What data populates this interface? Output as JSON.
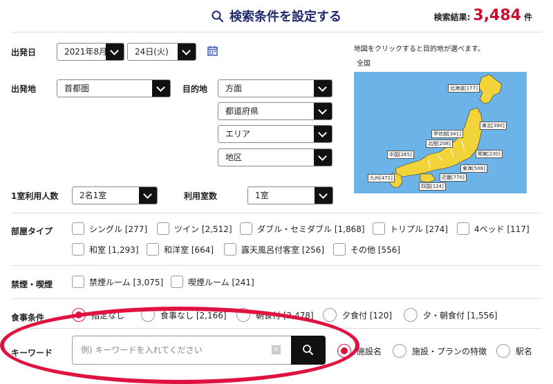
{
  "header": {
    "title": "検索条件を設定する",
    "results_label": "検索結果:",
    "results_count": "3,484",
    "results_unit": "件"
  },
  "departure_date": {
    "label": "出発日",
    "month": "2021年8月",
    "day": "24日(火)"
  },
  "departure_place": {
    "label": "出発地",
    "value": "首都圏"
  },
  "destination": {
    "label": "目的地",
    "selects": [
      "方面",
      "都道府県",
      "エリア",
      "地区"
    ]
  },
  "map": {
    "hint": "地図をクリックすると目的地が選べます。",
    "scope": "全国",
    "regions": [
      "北海道[177]",
      "東北[390]",
      "甲信越[341]",
      "北陸[208]",
      "関東[230]",
      "中国[265]",
      "東海[508]",
      "九州[471]",
      "近畿[770]",
      "四国[124]"
    ]
  },
  "persons": {
    "label": "1室利用人数",
    "value": "2名1室"
  },
  "rooms": {
    "label": "利用室数",
    "value": "1室"
  },
  "room_type": {
    "label": "部屋タイプ",
    "options": [
      "シングル [277]",
      "ツイン [2,512]",
      "ダブル・セミダブル [1,868]",
      "トリプル [274]",
      "4ベッド [117]",
      "和室 [1,293]",
      "和洋室 [664]",
      "露天風呂付客室 [256]",
      "その他 [556]"
    ]
  },
  "smoking": {
    "label": "禁煙・喫煙",
    "options": [
      "禁煙ルーム [3,075]",
      "喫煙ルーム [241]"
    ]
  },
  "meal": {
    "label": "食事条件",
    "options": [
      "指定なし",
      "食事なし [2,166]",
      "朝食付 [2,478]",
      "夕食付 [120]",
      "夕・朝食付 [1,556]"
    ]
  },
  "keyword": {
    "label": "キーワード",
    "placeholder": "例) キーワードを入れてください",
    "clear": "×",
    "modes": [
      "施設名",
      "施設・プランの特徴",
      "駅名"
    ]
  },
  "colors": {
    "accent": "#e0123f",
    "title": "#1f2b6e",
    "count": "#c8102e",
    "map_sea": "#6cb3e8",
    "map_land": "#f2d33a"
  }
}
